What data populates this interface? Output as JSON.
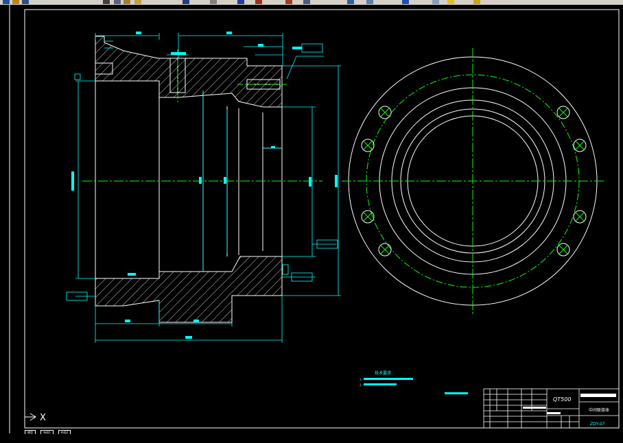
{
  "drawing": {
    "material": "QT500",
    "part_name": "中间联接体",
    "drawing_number": "ZDY-07",
    "technical_requirements_title": "技术要求",
    "tech_notes": [
      "1.",
      "2."
    ],
    "ucs_axis": "X"
  },
  "tabs": [
    {
      "label": "模型"
    },
    {
      "label": "布局1"
    },
    {
      "label": "布局2"
    }
  ],
  "colors": {
    "background": "#000000",
    "outline": "#ffffff",
    "dimension": "#00ffff",
    "centerline": "#00ff00",
    "hatch": "#ffffff"
  }
}
